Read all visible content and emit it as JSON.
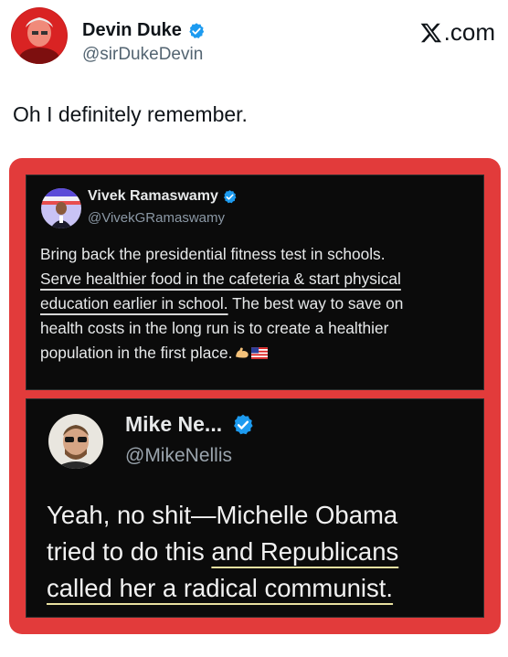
{
  "author": {
    "name": "Devin Duke",
    "handle": "@sirDukeDevin",
    "verified": true
  },
  "brand": {
    "label": ".com",
    "icon": "x-logo-icon"
  },
  "tweet": {
    "text": "Oh I definitely remember."
  },
  "quoted_post_1": {
    "name": "Vivek Ramaswamy",
    "handle": "@VivekGRamaswamy",
    "verified": true,
    "lines": [
      {
        "parts": [
          {
            "text": "Bring back the presidential fitness test in schools.",
            "underline": false
          }
        ]
      },
      {
        "parts": [
          {
            "text": "Serve healthier food in the cafeteria & start physical",
            "underline": true
          }
        ]
      },
      {
        "parts": [
          {
            "text": "education earlier in school.",
            "underline": true
          },
          {
            "text": " The best way to save on",
            "underline": false
          }
        ]
      },
      {
        "parts": [
          {
            "text": "health costs in the long run is to create a healthier",
            "underline": false
          }
        ]
      },
      {
        "parts": [
          {
            "text": "population in the first place.",
            "underline": false
          }
        ]
      }
    ],
    "trailing_emoji": [
      "flexed-biceps-emoji",
      "us-flag-emoji"
    ]
  },
  "quoted_post_2": {
    "name": "Mike Ne...",
    "handle": "@MikeNellis",
    "verified": true,
    "lines": [
      {
        "parts": [
          {
            "text": "Yeah, no shit—Michelle Obama",
            "underline": false
          }
        ]
      },
      {
        "parts": [
          {
            "text": "tried to do this ",
            "underline": false
          },
          {
            "text": "and Republicans",
            "underline": true
          }
        ]
      },
      {
        "parts": [
          {
            "text": "called her a radical communist.",
            "underline": true
          }
        ]
      }
    ]
  },
  "colors": {
    "frame_border": "#e23b3b",
    "panel_bg": "#0b0b0b",
    "verified_blue": "#1d9bf0"
  }
}
